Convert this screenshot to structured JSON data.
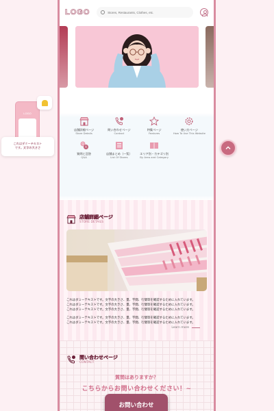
{
  "header": {
    "logo": "LOGO",
    "search_placeholder": "Stores, Restaurants, Clothes, etc.",
    "search_icon": "search-icon",
    "user_icon": "user-icon"
  },
  "float_widget": {
    "logo": "LOGO",
    "bubble_text_1": "これはダミーテキスト",
    "bubble_text_2": "です。文字の大きさ"
  },
  "float_top_button": {
    "icon": "chevron-up-icon"
  },
  "menu": {
    "items": [
      {
        "jp": "店舗詳細ページ",
        "en": "Store Details",
        "icon": "store-icon"
      },
      {
        "jp": "問い合わせページ",
        "en": "Contact",
        "icon": "phone-chat-icon"
      },
      {
        "jp": "特集ページ",
        "en": "Features",
        "icon": "star-icon"
      },
      {
        "jp": "使い方ページ",
        "en": "How To Use This Website",
        "icon": "gear-icon"
      },
      {
        "jp": "質問と回答",
        "en": "Q&A",
        "icon": "qa-icon"
      },
      {
        "jp": "店舗まとめ（一覧）",
        "en": "List Of Stores",
        "icon": "list-icon"
      },
      {
        "jp": "エリア別・カテゴリ別",
        "en": "By Area and Category",
        "icon": "book-icon"
      }
    ]
  },
  "store_section": {
    "title": "店舗詳細ページ",
    "subtitle": "STORE DETAILS",
    "paragraph_1_line_1": "これはダミーテキストです。文字の大きさ、量、字間、行間等を確認するために入れています。",
    "paragraph_1_line_2": "これはダミーテキストです。文字の大きさ、量、字間、行間等を確認するために入れています。",
    "paragraph_1_line_3": "これはダミーテキストです。文字の大きさ、量、字間、行間等を確認するために入れています。",
    "paragraph_2_line_1": "これはダミーテキストです。文字の大きさ、量、字間、行間等を確認するために入れています。",
    "paragraph_2_line_2": "これはダミーテキストです。文字の大きさ、量、字間、行間等を確認するために入れています。",
    "learn_more": "Learn more"
  },
  "contact_section": {
    "title": "問い合わせページ",
    "subtitle": "CONTACT",
    "question": "質問はありますか？",
    "call_to_action": "こちらからお問い合わせください！~",
    "button_label": "お問い合わせ"
  },
  "colors": {
    "accent": "#c86a80",
    "deep": "#6a1f37",
    "button": "#a1516b",
    "frame": "#d98ca0"
  }
}
